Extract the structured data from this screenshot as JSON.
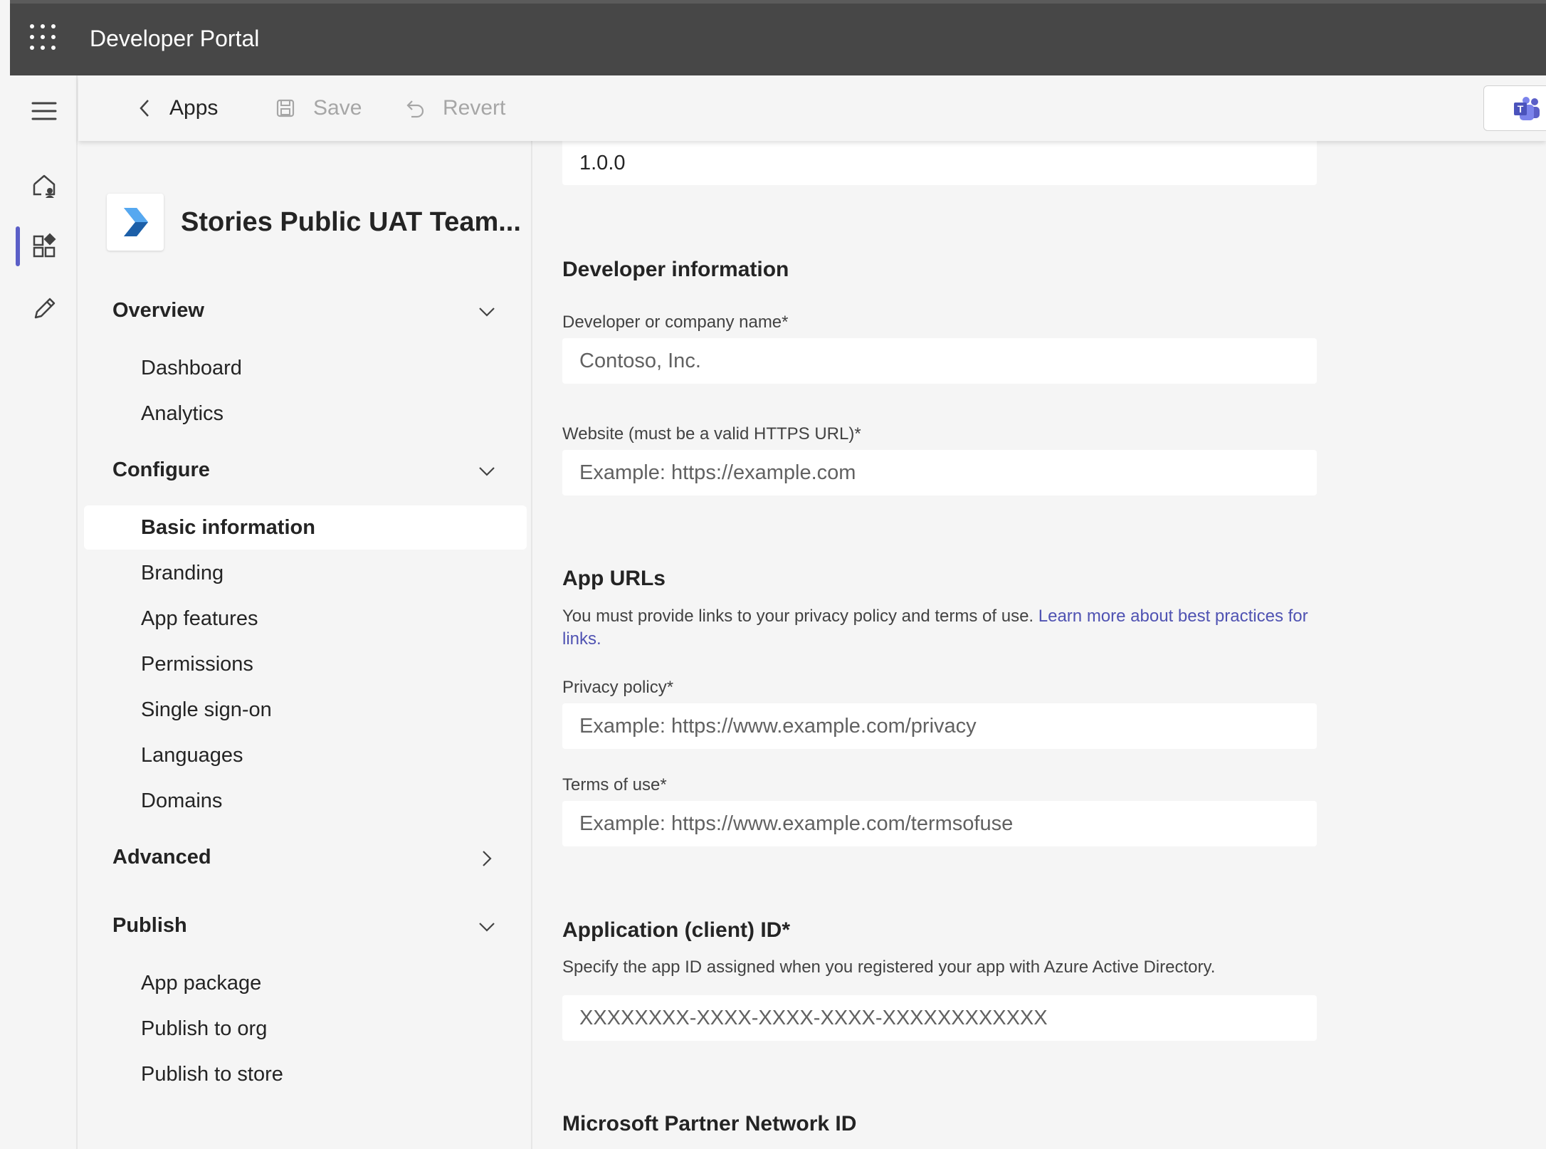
{
  "header": {
    "title": "Developer Portal"
  },
  "commandbar": {
    "back_label": "Apps",
    "save_label": "Save",
    "revert_label": "Revert"
  },
  "app": {
    "name": "Stories Public UAT Team..."
  },
  "nav": {
    "overview": {
      "label": "Overview",
      "items": [
        "Dashboard",
        "Analytics"
      ]
    },
    "configure": {
      "label": "Configure",
      "items": [
        "Basic information",
        "Branding",
        "App features",
        "Permissions",
        "Single sign-on",
        "Languages",
        "Domains"
      ],
      "selected": "Basic information"
    },
    "advanced": {
      "label": "Advanced"
    },
    "publish": {
      "label": "Publish",
      "items": [
        "App package",
        "Publish to org",
        "Publish to store"
      ]
    }
  },
  "form": {
    "version_value": "1.0.0",
    "developer_info": {
      "heading": "Developer information",
      "company_label": "Developer or company name",
      "company_value": "Contoso, Inc.",
      "website_label": "Website (must be a valid HTTPS URL)",
      "website_placeholder": "Example: https://example.com"
    },
    "app_urls": {
      "heading": "App URLs",
      "description": "You must provide links to your privacy policy and terms of use. ",
      "link_text": "Learn more about best practices for links.",
      "privacy_label": "Privacy policy",
      "privacy_placeholder": "Example: https://www.example.com/privacy",
      "terms_label": "Terms of use",
      "terms_placeholder": "Example: https://www.example.com/termsofuse"
    },
    "client_id": {
      "heading": "Application (client) ID",
      "description": "Specify the app ID assigned when you registered your app with Azure Active Directory.",
      "placeholder": "XXXXXXXX-XXXX-XXXX-XXXX-XXXXXXXXXXXX"
    },
    "mpn": {
      "heading": "Microsoft Partner Network ID"
    },
    "required_mark": "*"
  },
  "colors": {
    "topbar": "#474747",
    "accent": "#5b5fc7",
    "link": "#4f52b2",
    "background": "#f5f5f5"
  }
}
